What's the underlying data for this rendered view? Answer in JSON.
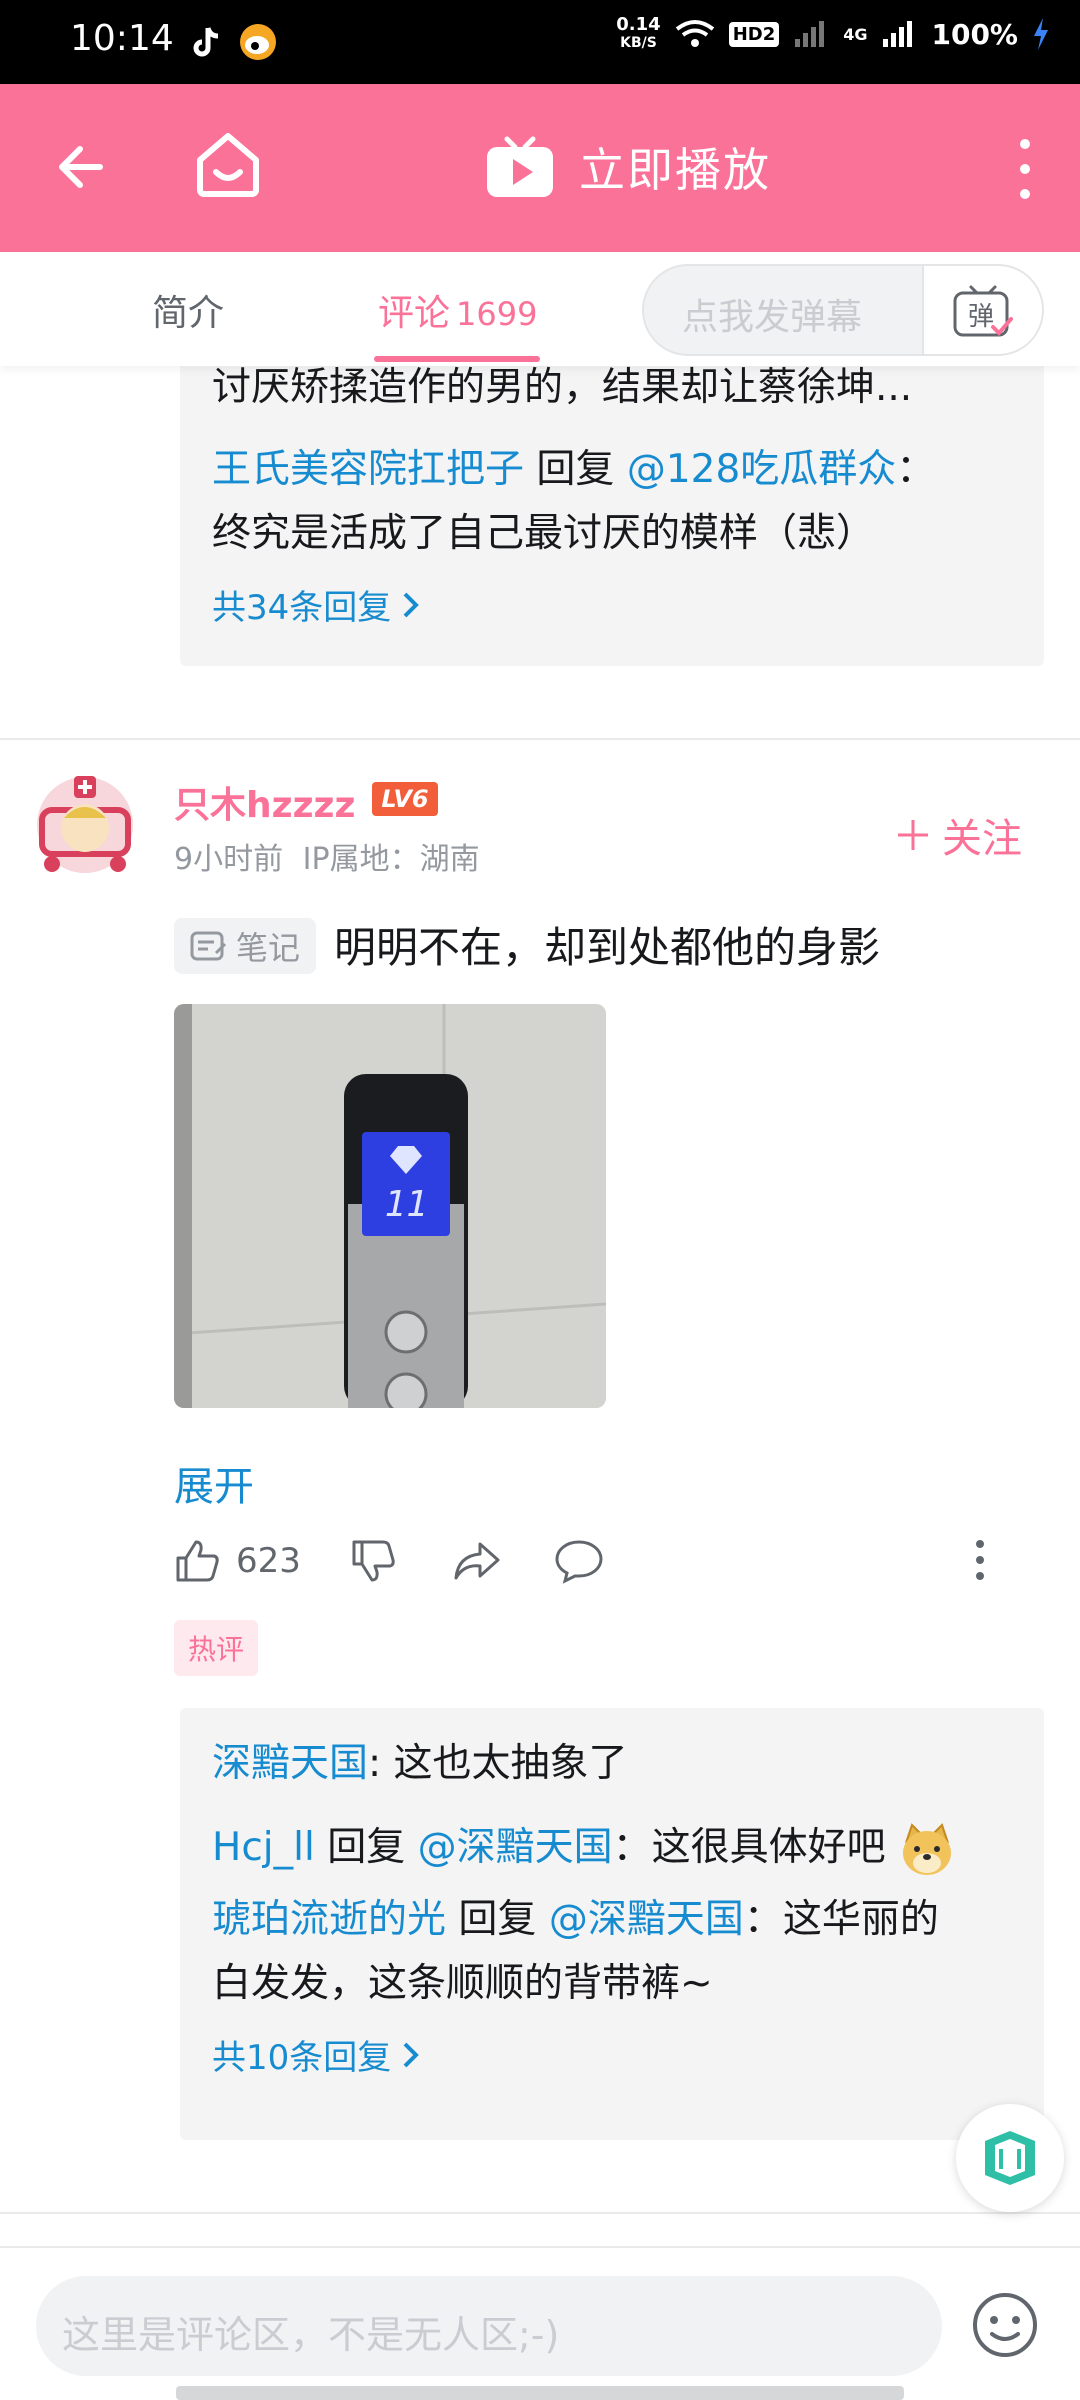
{
  "status_bar": {
    "time": "10:14",
    "net_speed_value": "0.14",
    "net_speed_unit": "KB/S",
    "hd_label": "HD2",
    "network_label": "4G",
    "battery": "100%"
  },
  "header": {
    "play_label": "立即播放"
  },
  "tabs": {
    "intro": "简介",
    "comments": "评论",
    "comments_count": "1699",
    "danmaku_placeholder": "点我发弹幕",
    "danmaku_button": "弹"
  },
  "prev_comment": {
    "truncated_line": "讨厌矫揉造作的男的，结果却让蔡徐坤...",
    "reply": {
      "user": "王氏美容院扛把子",
      "reply_word": "回复",
      "target": "@128吃瓜群众",
      "text_1": "：",
      "text_2": "终究是活成了自己最讨厌的模样（悲）"
    },
    "more_replies": "共34条回复"
  },
  "comment": {
    "username": "只木hzzzz",
    "level": "LV6",
    "time": "9小时前",
    "ip": "IP属地：湖南",
    "follow": "关注",
    "note_tag": "笔记",
    "text": "明明不在，却到处都他的身影",
    "image_floor": "11",
    "expand": "展开",
    "likes": "623",
    "hot_tag": "热评",
    "replies": [
      {
        "user": "深黯天国",
        "sep": ":",
        "text": " 这也太抽象了"
      },
      {
        "user": "Hcj_ll",
        "reply_word": "回复",
        "target": "@深黯天国",
        "text": "：这很具体好吧"
      },
      {
        "user": "琥珀流逝的光",
        "reply_word": "回复",
        "target": "@深黯天国",
        "text": "：这华丽的",
        "text_2": "白发发，这条顺顺的背带裤~"
      }
    ],
    "more_replies": "共10条回复"
  },
  "bottom": {
    "placeholder": "这里是评论区，不是无人区;-)"
  },
  "colors": {
    "brand_pink": "#fb7299",
    "link_blue": "#178bcf",
    "level_orange": "#f25d3a"
  }
}
